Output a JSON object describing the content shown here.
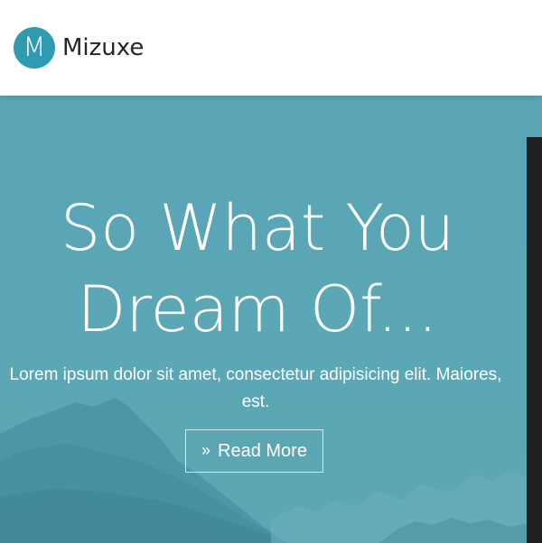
{
  "nav": {
    "logo_letter": "M",
    "brand": "Mizuxe"
  },
  "hero": {
    "headline_line1": "So What You",
    "headline_line2": "Dream Of...",
    "subtext": "Lorem ipsum dolor sit amet, consectetur adipisicing elit. Maiores, est.",
    "cta_label": "Read More",
    "cta_icon": "double-chevron-right-icon"
  },
  "colors": {
    "brand_accent": "#2f9bb1",
    "hero_background": "#5aa6b6",
    "side_panel": "#212121"
  }
}
